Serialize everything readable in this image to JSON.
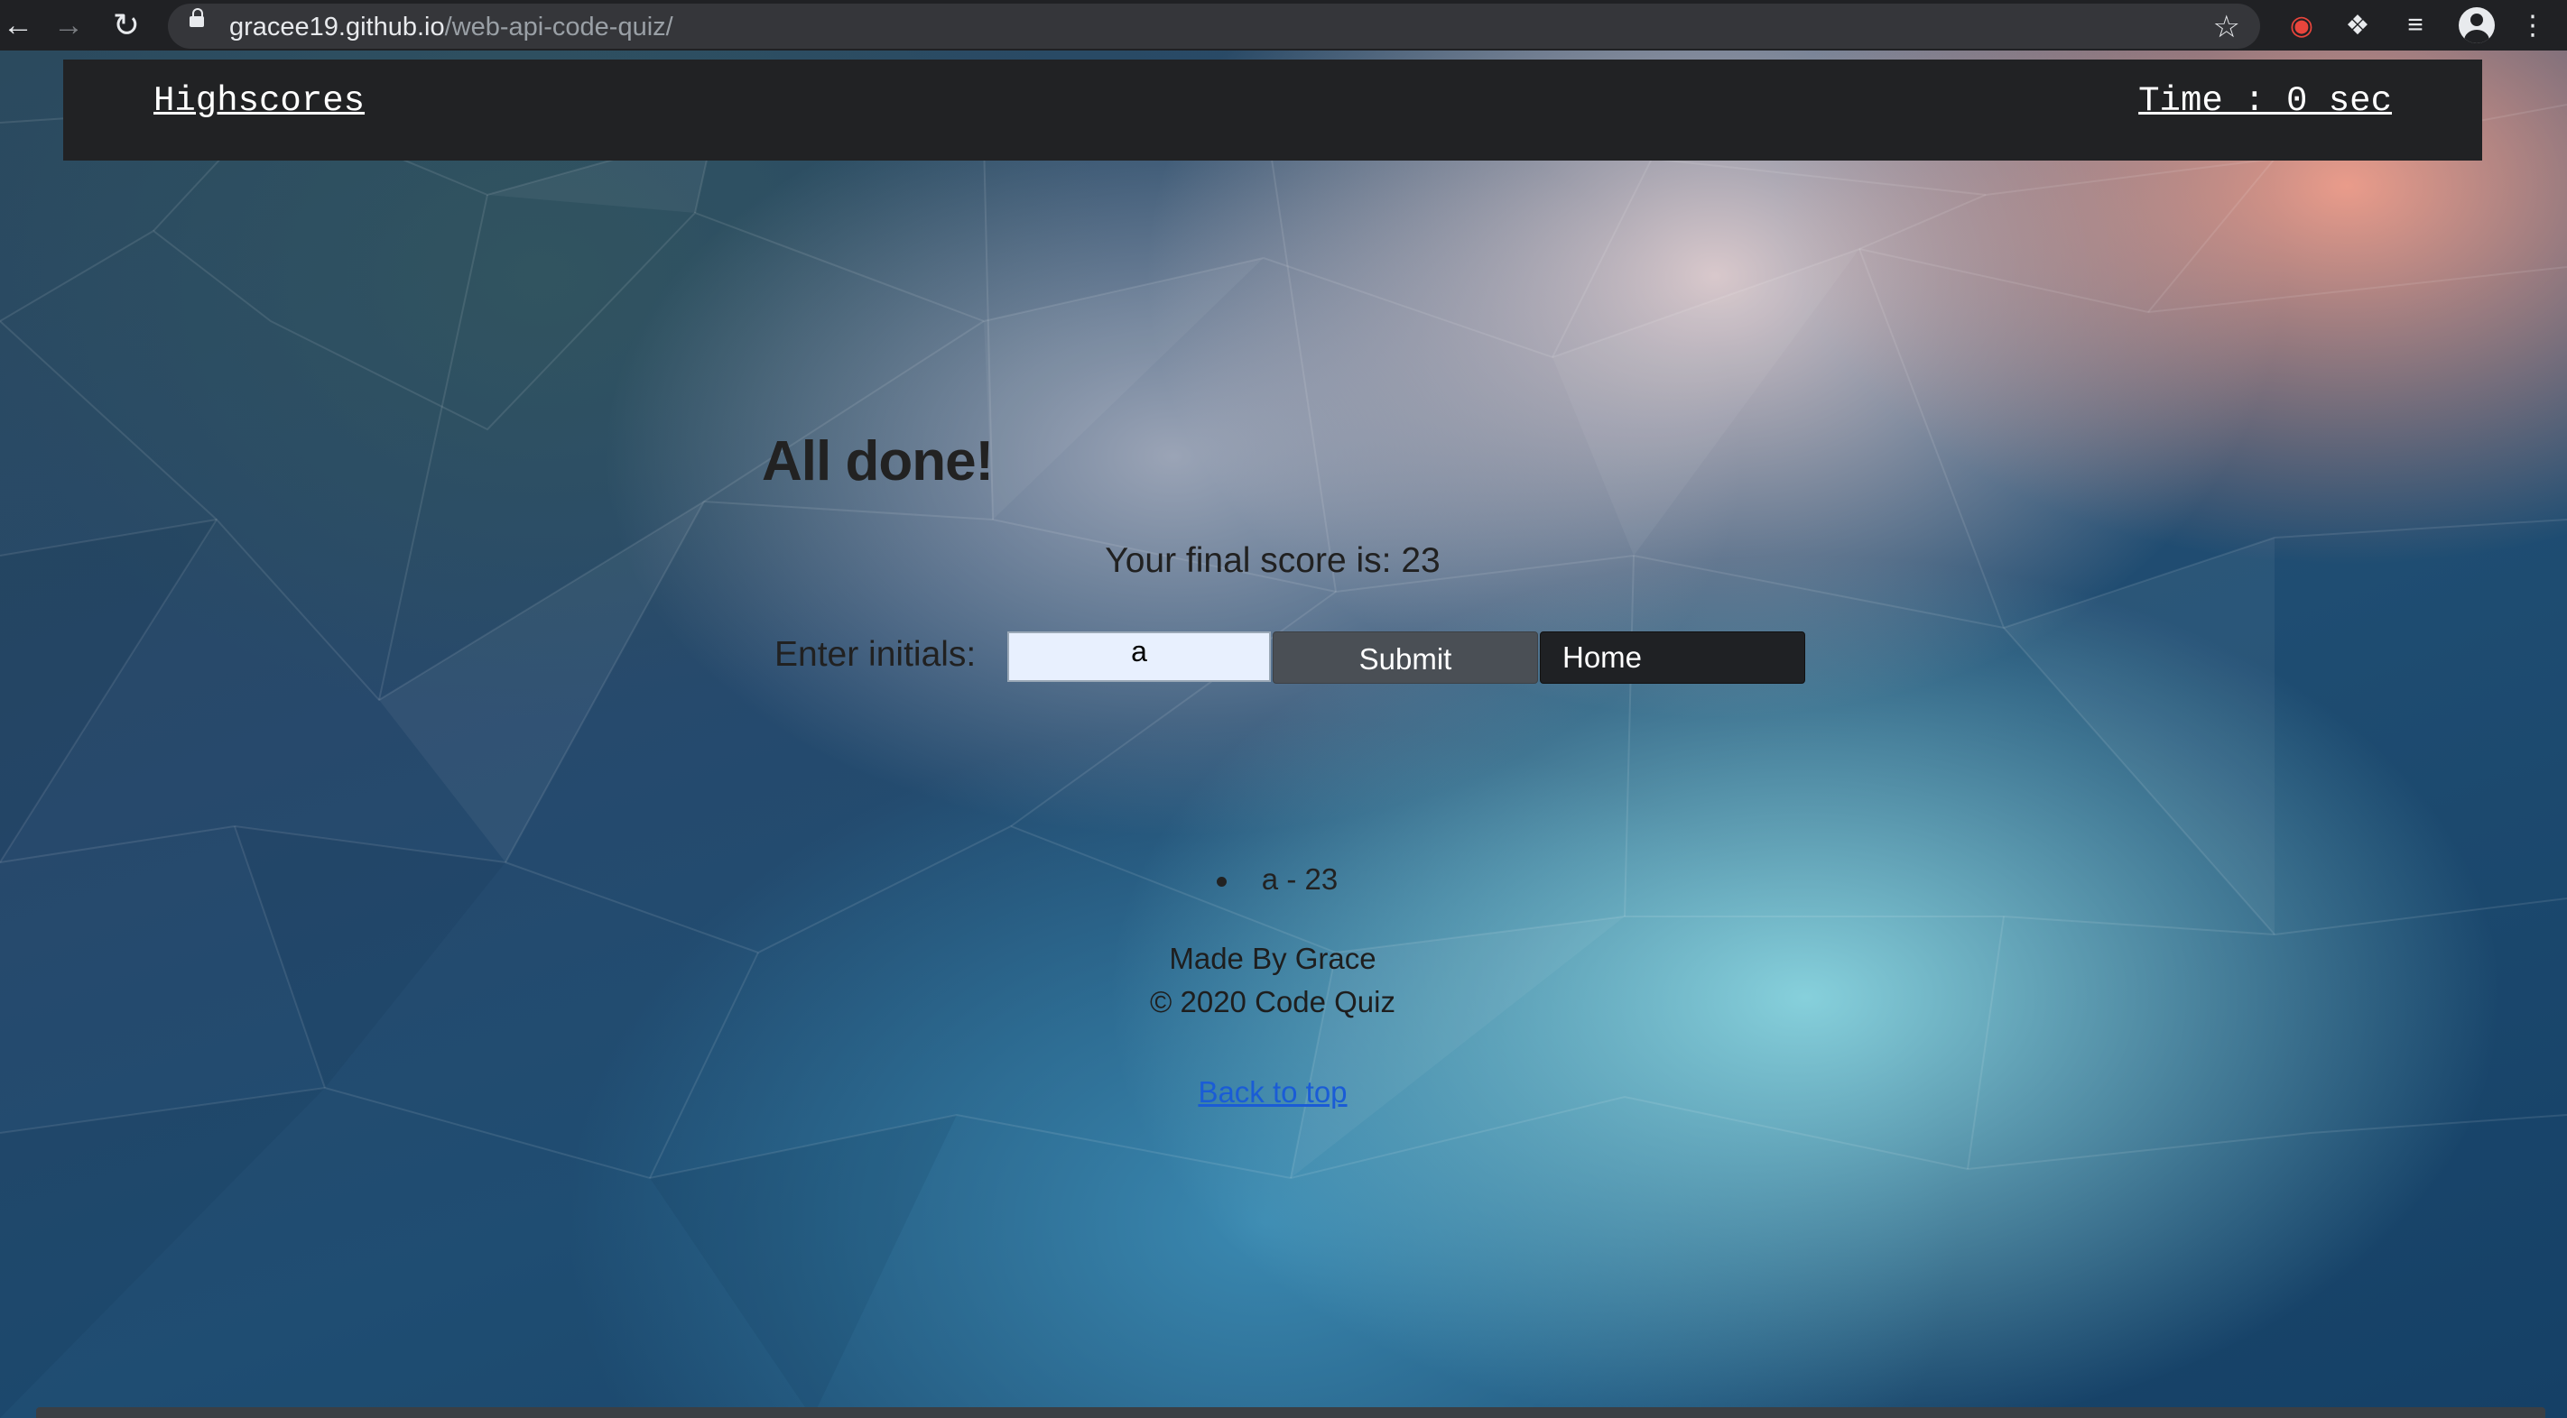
{
  "browser": {
    "url_host": "gracee19.github.io",
    "url_path": "/web-api-code-quiz/",
    "back_icon": "arrow-left",
    "forward_icon": "arrow-right",
    "reload_icon": "reload",
    "star_icon": "star-outline"
  },
  "header": {
    "highscores_label": "Highscores",
    "timer_label": "Time : 0 sec",
    "background_color": "#212224"
  },
  "quiz": {
    "title": "All done!",
    "final_score_text": "Your final score is: 23",
    "initials_label": "Enter initials:",
    "initials_value": "a",
    "submit_label": "Submit",
    "home_label": "Home"
  },
  "scores": [
    {
      "entry": "a - 23"
    }
  ],
  "footer": {
    "made_by": "Made By Grace",
    "copyright": "© 2020 Code Quiz",
    "back_to_top": "Back to top"
  },
  "colors": {
    "link": "#1a5cd6",
    "submit_bg": "#4a4f55",
    "home_bg": "#1f2124",
    "input_bg": "#e8f0fe"
  }
}
